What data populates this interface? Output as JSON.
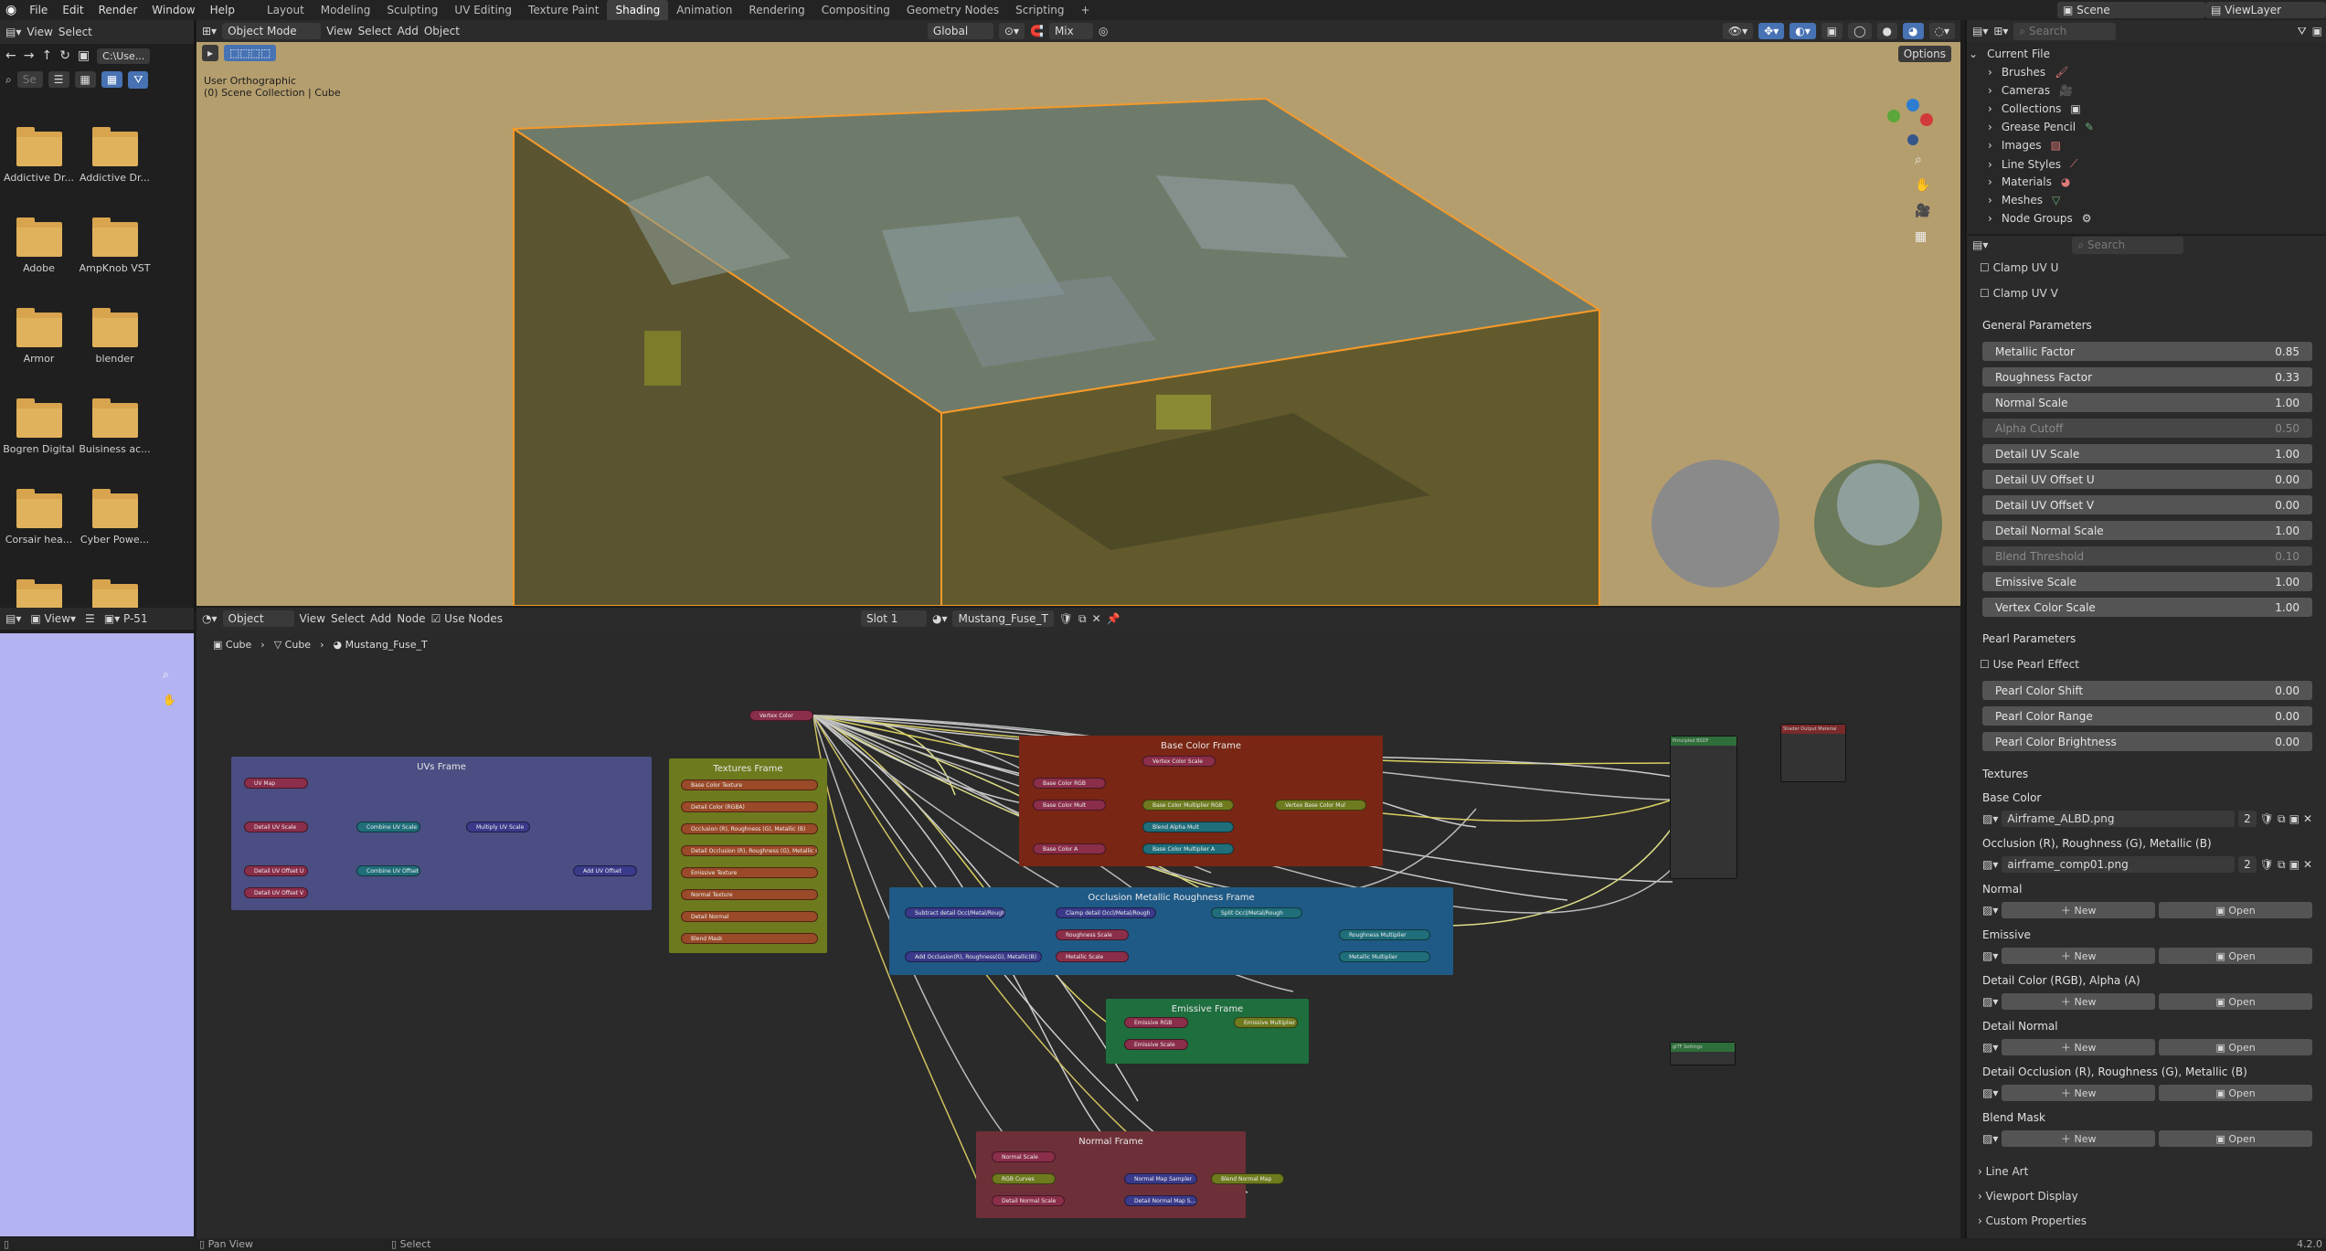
{
  "menu": [
    "File",
    "Edit",
    "Render",
    "Window",
    "Help"
  ],
  "workspaces": [
    "Layout",
    "Modeling",
    "Sculpting",
    "UV Editing",
    "Texture Paint",
    "Shading",
    "Animation",
    "Rendering",
    "Compositing",
    "Geometry Nodes",
    "Scripting",
    "+"
  ],
  "active_workspace": "Shading",
  "scene_label": "Scene",
  "view_layer_label": "ViewLayer",
  "file_browser": {
    "view": "View",
    "select": "Select",
    "path": "C:\\Use...",
    "search_placeholder": "Se",
    "items": [
      "Addictive Dr...",
      "Addictive Dr...",
      "Adobe",
      "AmpKnob VST",
      "Armor",
      "blender",
      "Bogren Digital",
      "Buisiness ac...",
      "Corsair hea...",
      "Cyber Powe..."
    ]
  },
  "viewport": {
    "mode": "Object Mode",
    "menu": [
      "View",
      "Select",
      "Add",
      "Object"
    ],
    "orientation": "Global",
    "pivot": "Mix",
    "overlay_text_1": "User Orthographic",
    "overlay_text_2": "(0) Scene Collection | Cube",
    "options": "Options"
  },
  "image_editor": {
    "view": "View",
    "image": "P-51"
  },
  "node_editor": {
    "editor_type": "Object",
    "menu": [
      "View",
      "Select",
      "Add",
      "Node"
    ],
    "use_nodes": "Use Nodes",
    "slot": "Slot 1",
    "material": "Mustang_Fuse_T",
    "breadcrumb": [
      "Cube",
      "Cube",
      "Mustang_Fuse_T"
    ],
    "frames": {
      "uvs": "UVs Frame",
      "textures": "Textures Frame",
      "base_color": "Base Color Frame",
      "occlusion": "Occlusion Metallic Roughness Frame",
      "emissive": "Emissive Frame",
      "normal": "Normal Frame"
    },
    "nodes": {
      "vertex_color": "Vertex Color",
      "uv_map": "UV Map",
      "detail_uv_scale": "Detail UV Scale",
      "combine_uv_scale": "Combine UV Scale",
      "multiply_uv_scale": "Multiply UV Scale",
      "detail_uv_offset_u": "Detail UV Offset U",
      "detail_uv_offset_v": "Detail UV Offset V",
      "combine_uv_offset": "Combine UV Offset",
      "add_uv_offset": "Add UV Offset",
      "textures": [
        "Base Color Texture",
        "Detail Color (RGBA)",
        "Occlusion (R), Roughness (G), Metallic (B)",
        "Detail Occlusion (R), Roughness (G), Metallic (B)",
        "Emissive Texture",
        "Normal Texture",
        "Detail Normal",
        "Blend Mask"
      ],
      "base_color_nodes": [
        "Vertex Color Scale",
        "Base Color RGB",
        "Base Color Mult",
        "Base Color Multiplier RGB",
        "Blend Alpha Mult",
        "Base Color Multiplier A",
        "Base Color A",
        "Vertex Base Color Mul"
      ],
      "orm_nodes": [
        "Subtract detail Occl/Metal/Rough",
        "Clamp detail Occl/Metal/Rough",
        "Split Occl/Metal/Rough",
        "Roughness Scale",
        "Metallic Scale",
        "Add Occlusion(R), Roughness(G), Metallic(B)",
        "Roughness Multiplier",
        "Metallic Multiplier"
      ],
      "emissive_nodes": [
        "Emissive RGB",
        "Emissive Scale",
        "Emissive Multiplier"
      ],
      "normal_nodes": [
        "Normal Scale",
        "RGB Curves",
        "Detail Normal Scale",
        "Normal Map Sampler",
        "Detail Normal Map S...",
        "Blend Normal Map"
      ],
      "principled": "Principled BSDF",
      "output": "Shader Output Material",
      "gltf": "glTF Settings"
    }
  },
  "outliner": {
    "search_placeholder": "Search",
    "root": "Current File",
    "items": [
      "Brushes",
      "Cameras",
      "Collections",
      "Grease Pencil",
      "Images",
      "Line Styles",
      "Materials",
      "Meshes",
      "Node Groups"
    ]
  },
  "properties": {
    "search_placeholder": "Search",
    "clamp_u": "Clamp UV U",
    "clamp_v": "Clamp UV V",
    "general_header": "General Parameters",
    "general": [
      {
        "label": "Metallic Factor",
        "value": "0.85",
        "dim": false
      },
      {
        "label": "Roughness Factor",
        "value": "0.33",
        "dim": false
      },
      {
        "label": "Normal Scale",
        "value": "1.00",
        "dim": false
      },
      {
        "label": "Alpha Cutoff",
        "value": "0.50",
        "dim": true
      },
      {
        "label": "Detail UV Scale",
        "value": "1.00",
        "dim": false
      },
      {
        "label": "Detail UV Offset U",
        "value": "0.00",
        "dim": false
      },
      {
        "label": "Detail UV Offset V",
        "value": "0.00",
        "dim": false
      },
      {
        "label": "Detail Normal Scale",
        "value": "1.00",
        "dim": false
      },
      {
        "label": "Blend Threshold",
        "value": "0.10",
        "dim": true
      },
      {
        "label": "Emissive Scale",
        "value": "1.00",
        "dim": false
      },
      {
        "label": "Vertex Color Scale",
        "value": "1.00",
        "dim": false
      }
    ],
    "pearl_header": "Pearl Parameters",
    "use_pearl": "Use Pearl Effect",
    "pearl": [
      {
        "label": "Pearl Color Shift",
        "value": "0.00"
      },
      {
        "label": "Pearl Color Range",
        "value": "0.00"
      },
      {
        "label": "Pearl Color Brightness",
        "value": "0.00"
      }
    ],
    "textures_header": "Textures",
    "base_color_label": "Base Color",
    "base_color_file": "Airframe_ALBD.png",
    "base_color_users": "2",
    "orm_label": "Occlusion (R), Roughness (G), Metallic (B)",
    "orm_file": "airframe_comp01.png",
    "orm_users": "2",
    "empty_slots": [
      "Normal",
      "Emissive",
      "Detail Color (RGB), Alpha (A)",
      "Detail Normal",
      "Detail Occlusion (R), Roughness (G), Metallic (B)",
      "Blend Mask"
    ],
    "new_label": "New",
    "open_label": "Open",
    "collapsed": [
      "Line Art",
      "Viewport Display",
      "Custom Properties"
    ]
  },
  "status": {
    "left": "Pan View",
    "mid": "Select",
    "version": "4.2.0"
  }
}
